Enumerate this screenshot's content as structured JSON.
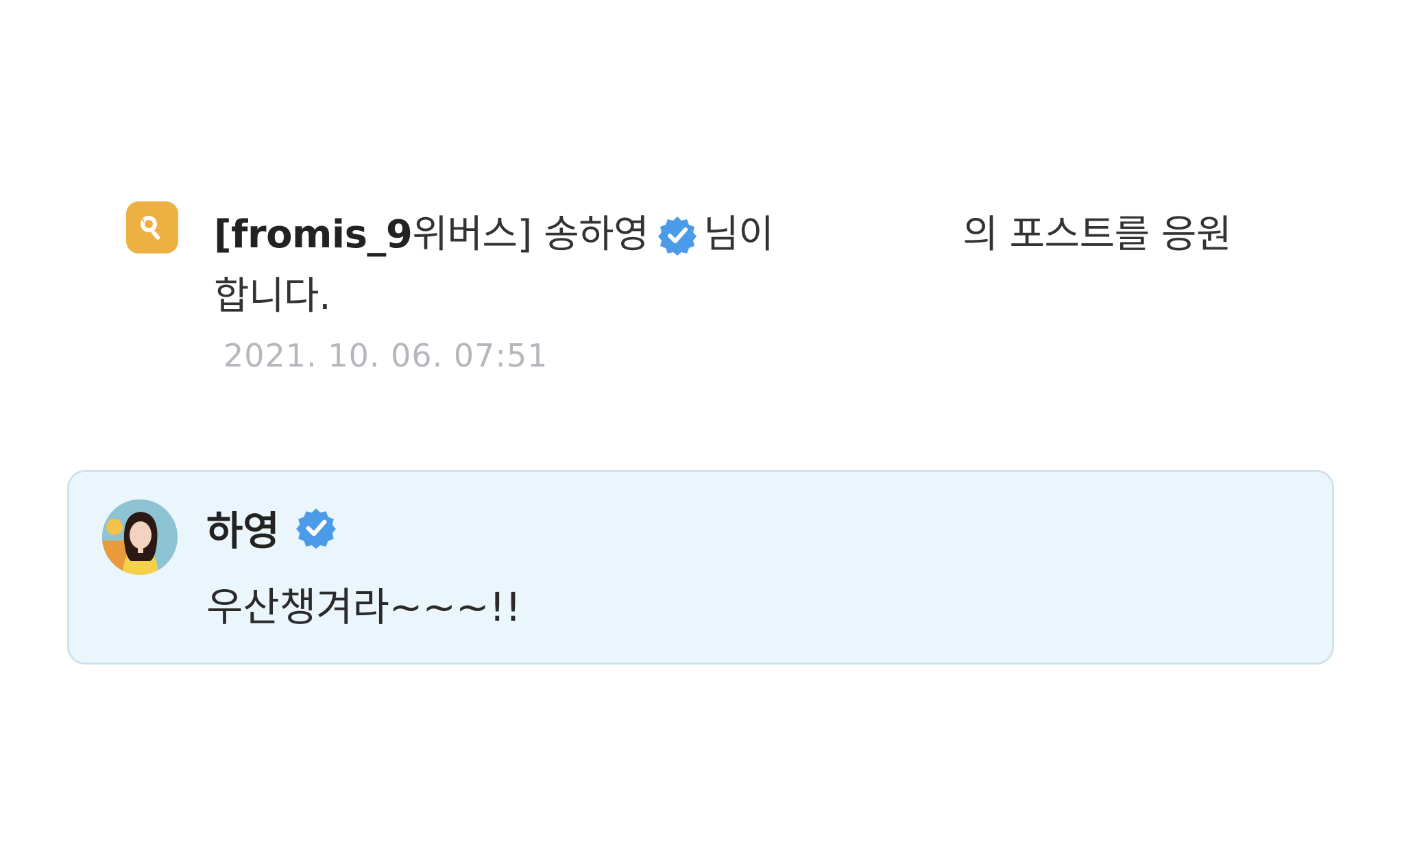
{
  "notification": {
    "app_icon": "weverse-fan-icon",
    "sender_bold": "[fromis_9",
    "sender_rest": " 위버스] 송하영",
    "suffix": "님이",
    "action": "의 포스트를 응원",
    "action_line2": "합니다.",
    "timestamp": "2021. 10. 06. 07:51"
  },
  "comment": {
    "avatar": "profile-photo",
    "author": "하영",
    "text": "우산챙겨라~~~!!"
  },
  "colors": {
    "accent_orange": "#efb043",
    "verified_blue": "#4b9be8",
    "card_bg": "#ebf6fc",
    "timestamp_gray": "#b4b7bc"
  }
}
